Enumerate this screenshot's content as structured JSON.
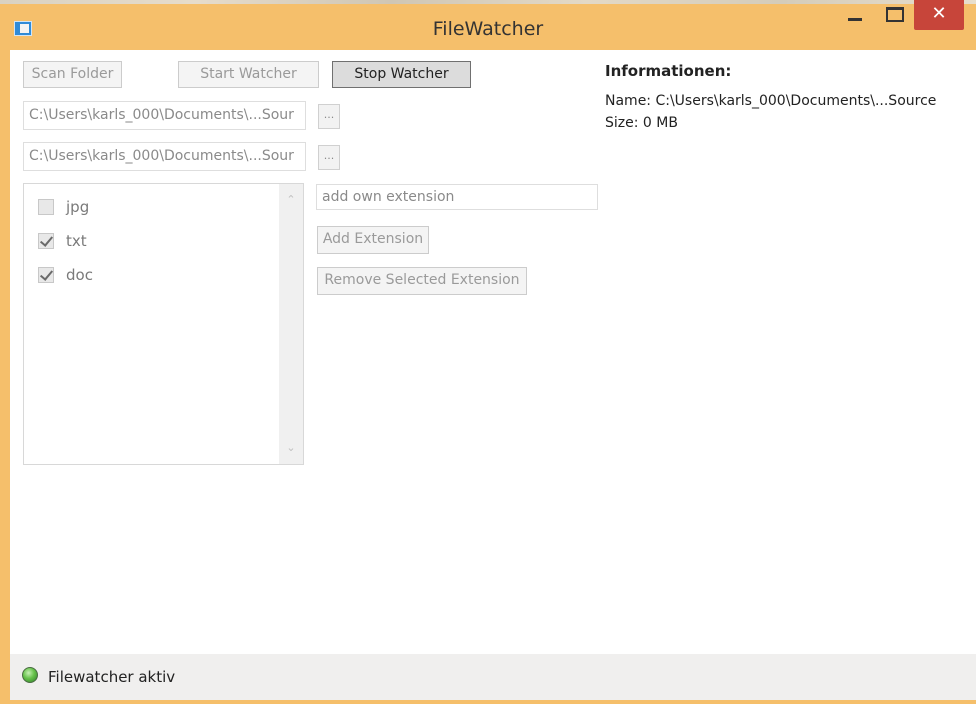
{
  "window": {
    "title": "FileWatcher",
    "close_glyph": "✕",
    "accent_color": "#f5bf6b"
  },
  "toolbar": {
    "scan_folder": "Scan Folder",
    "start_watcher": "Start Watcher",
    "stop_watcher": "Stop Watcher"
  },
  "paths": {
    "source_path": "C:\\Users\\karls_000\\Documents\\...Sour",
    "target_path": "C:\\Users\\karls_000\\Documents\\...Sour",
    "browse_label": "..."
  },
  "extensions": {
    "items": [
      {
        "label": "jpg",
        "checked": false
      },
      {
        "label": "txt",
        "checked": true
      },
      {
        "label": "doc",
        "checked": true
      }
    ],
    "scroll_up": "⌃",
    "scroll_down": "⌄"
  },
  "extension_editor": {
    "placeholder": "add own extension",
    "add_button": "Add Extension",
    "remove_button": "Remove Selected Extension"
  },
  "info": {
    "title": "Informationen:",
    "name_line": "Name: C:\\Users\\karls_000\\Documents\\...Source",
    "size_line": "Size: 0 MB"
  },
  "status": {
    "text": "Filewatcher aktiv",
    "led_color": "#66c24a"
  }
}
